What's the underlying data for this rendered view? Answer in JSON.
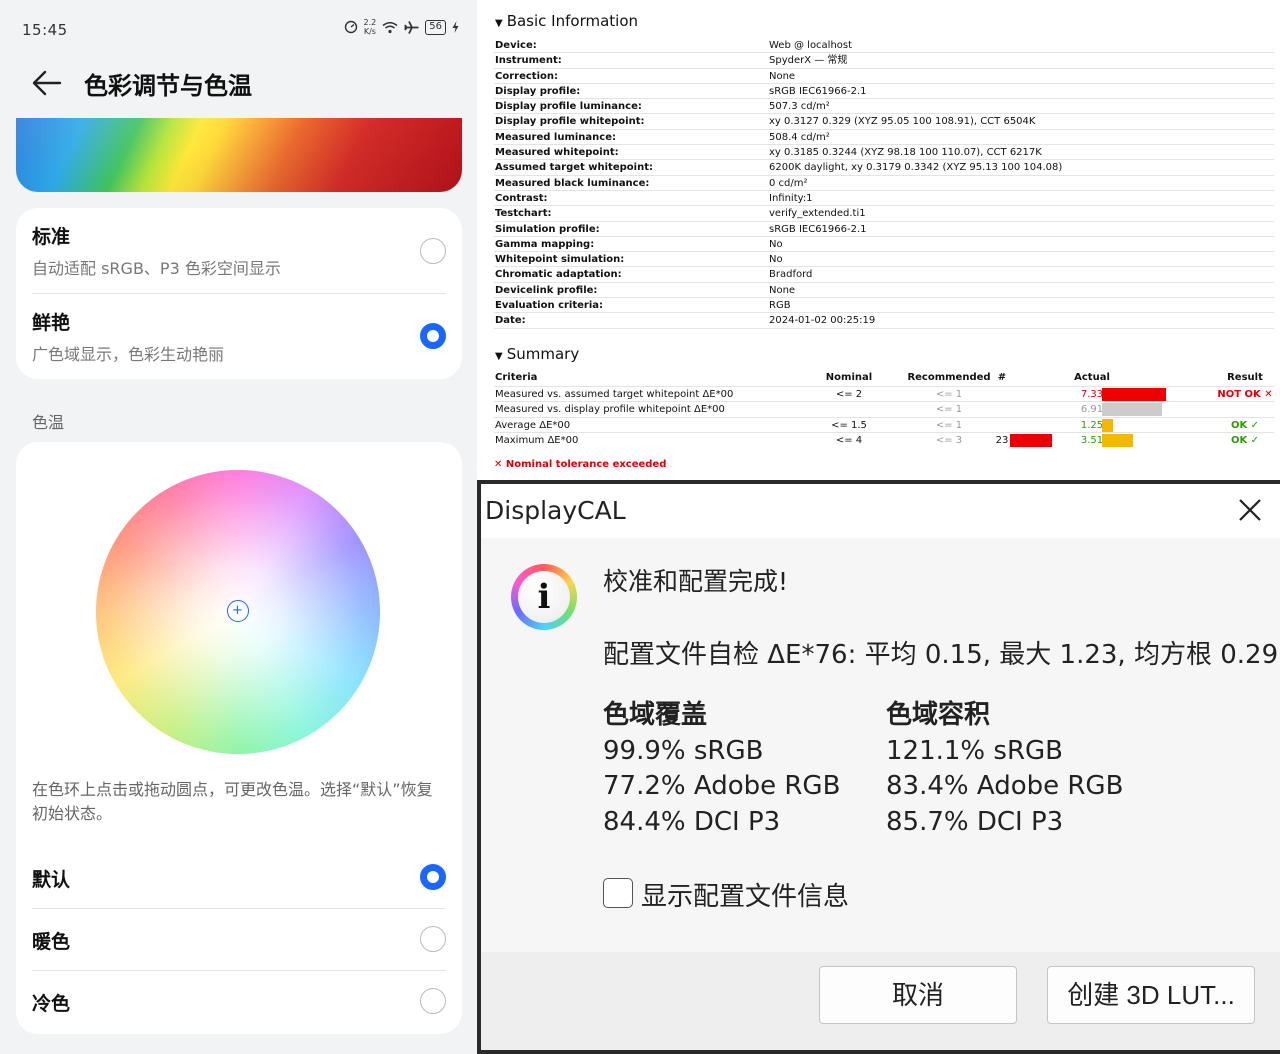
{
  "phone": {
    "status": {
      "time": "15:45",
      "speed_value": "2.2",
      "speed_unit": "K/s",
      "battery": "56"
    },
    "title": "色彩调节与色温",
    "modes": [
      {
        "title": "标准",
        "subtitle": "自动适配 sRGB、P3 色彩空间显示",
        "selected": false
      },
      {
        "title": "鲜艳",
        "subtitle": "广色域显示，色彩生动艳丽",
        "selected": true
      }
    ],
    "color_temp_label": "色温",
    "color_temp_hint": "在色环上点击或拖动圆点，可更改色温。选择“默认”恢复初始状态。",
    "temp_options": [
      {
        "label": "默认",
        "selected": true
      },
      {
        "label": "暖色",
        "selected": false
      },
      {
        "label": "冷色",
        "selected": false
      }
    ]
  },
  "report": {
    "basic_title": "Basic Information",
    "basic_info": [
      {
        "key": "Device:",
        "value": "Web @ localhost"
      },
      {
        "key": "Instrument:",
        "value": "SpyderX — 常规"
      },
      {
        "key": "Correction:",
        "value": "None"
      },
      {
        "key": "Display profile:",
        "value": "sRGB IEC61966-2.1"
      },
      {
        "key": "Display profile luminance:",
        "value": "507.3 cd/m²"
      },
      {
        "key": "Display profile whitepoint:",
        "value": "xy 0.3127 0.329 (XYZ 95.05 100 108.91), CCT 6504K"
      },
      {
        "key": "Measured luminance:",
        "value": "508.4 cd/m²"
      },
      {
        "key": "Measured whitepoint:",
        "value": "xy 0.3185 0.3244 (XYZ 98.18 100 110.07), CCT 6217K"
      },
      {
        "key": "Assumed target whitepoint:",
        "value": "6200K daylight, xy 0.3179 0.3342 (XYZ 95.13 100 104.08)"
      },
      {
        "key": "Measured black luminance:",
        "value": "0 cd/m²"
      },
      {
        "key": "Contrast:",
        "value": "Infinity:1"
      },
      {
        "key": "Testchart:",
        "value": "verify_extended.ti1"
      },
      {
        "key": "Simulation profile:",
        "value": "sRGB IEC61966-2.1"
      },
      {
        "key": "Gamma mapping:",
        "value": "No"
      },
      {
        "key": "Whitepoint simulation:",
        "value": "No"
      },
      {
        "key": "Chromatic adaptation:",
        "value": "Bradford"
      },
      {
        "key": "Devicelink profile:",
        "value": "None"
      },
      {
        "key": "Evaluation criteria:",
        "value": "RGB"
      },
      {
        "key": "Date:",
        "value": "2024-01-02 00:25:19"
      }
    ],
    "summary_title": "Summary",
    "summary_headers": {
      "criteria": "Criteria",
      "nominal": "Nominal",
      "recommended": "Recommended",
      "hash": "#",
      "actual": "Actual",
      "result": "Result"
    },
    "summary_rows": [
      {
        "criteria": "Measured vs. assumed target whitepoint ΔE*00",
        "nominal": "<= 2",
        "recommended": "<= 1",
        "hash": "",
        "actual": "7.33",
        "actual_color": "#e00000",
        "bar_color": "#ee0000",
        "bar_fraction": 1.0,
        "hash_bar": false,
        "result": "NOT OK ✕",
        "result_color": "#e00000"
      },
      {
        "criteria": "Measured vs. display profile whitepoint ΔE*00",
        "nominal": "",
        "recommended": "<= 1",
        "hash": "",
        "actual": "6.91",
        "actual_color": "#999999",
        "bar_color": "#cccccc",
        "bar_fraction": 0.94,
        "hash_bar": false,
        "result": "",
        "result_color": "#999999"
      },
      {
        "criteria": "Average ΔE*00",
        "nominal": "<= 1.5",
        "recommended": "<= 1",
        "hash": "",
        "actual": "1.25",
        "actual_color": "#2a9d00",
        "bar_color": "#f5b800",
        "bar_fraction": 0.17,
        "hash_bar": false,
        "result": "OK ✓",
        "result_color": "#2a9d00"
      },
      {
        "criteria": "Maximum ΔE*00",
        "nominal": "<= 4",
        "recommended": "<= 3",
        "hash": "23",
        "actual": "3.51",
        "actual_color": "#2a9d00",
        "bar_color": "#f5b800",
        "bar_fraction": 0.48,
        "hash_bar": true,
        "result": "OK ✓",
        "result_color": "#2a9d00"
      }
    ],
    "note": "✕ Nominal tolerance exceeded"
  },
  "dialog": {
    "title": "DisplayCAL",
    "headline": "校准和配置完成!",
    "stats": "配置文件自检 ΔE*76: 平均 0.15, 最大 1.23, 均方根 0.29",
    "coverage": {
      "heading": "色域覆盖",
      "lines": [
        "99.9% sRGB",
        "77.2% Adobe RGB",
        "84.4% DCI P3"
      ]
    },
    "volume": {
      "heading": "色域容积",
      "lines": [
        "121.1% sRGB",
        "83.4% Adobe RGB",
        "85.7% DCI P3"
      ]
    },
    "checkbox_label": "显示配置文件信息",
    "checkbox_checked": false,
    "cancel_label": "取消",
    "lut_label": "创建 3D LUT..."
  },
  "colors": {
    "accent_blue": "#1a66ff",
    "fail_red": "#e00000",
    "ok_green": "#2a9d00",
    "warn_yellow": "#f5b800"
  }
}
